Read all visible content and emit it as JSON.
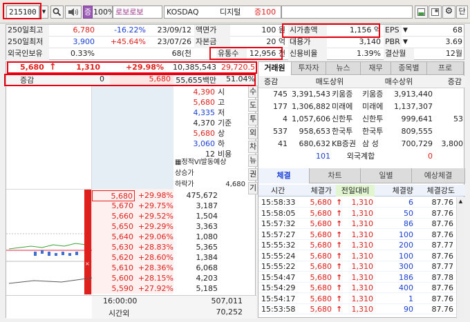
{
  "toolbar": {
    "code": "215100",
    "dropdown_glyph": "▾",
    "search_glyph": "🔍",
    "speaker_glyph": "◀)",
    "badge": "증",
    "margin": "100%",
    "name": "로보로보",
    "market": "KOSDAQ",
    "sector": "디지털",
    "margin_rate": "증100",
    "settings_glyph": "⚙",
    "single_label": "단"
  },
  "info": {
    "high250_label": "250일최고",
    "high250_value": "6,780",
    "high250_pct": "-16.22%",
    "high250_date": "23/09/12",
    "par_label": "액면가",
    "par_value": "100 원",
    "mcap_label": "시가총액",
    "mcap_value": "1,156 억",
    "eps_label": "EPS",
    "eps_value": "68",
    "low250_label": "250일최저",
    "low250_value": "3,900",
    "low250_pct": "+45.64%",
    "low250_date": "23/07/26",
    "capital_label": "자본금",
    "capital_value": "20 억",
    "loan_label": "대용가",
    "loan_value": "3,140",
    "pbr_label": "PBR",
    "pbr_value": "3.69",
    "foreign_label": "외국인보유",
    "foreign_value": "0.33%",
    "shares_value": "68(천",
    "float_label": "유통수",
    "float_value": "12,956 천",
    "credit_label": "신용비율",
    "credit_value": "1.39%",
    "fiscal_label": "결산월",
    "fiscal_value": "12월"
  },
  "quote": {
    "price": "5,680",
    "arrow": "↑",
    "change": "1,310",
    "pct": "+29.98%",
    "volume": "10,385,543",
    "amount": "29,720.5",
    "diff_label": "증감",
    "diff_value": "0",
    "ref_price": "5,680",
    "trade_amount": "55,655백만",
    "strength": "51.04%"
  },
  "summary": [
    {
      "value": "4,390",
      "label": "시"
    },
    {
      "value": "5,680",
      "label": "고"
    },
    {
      "value": "4,335",
      "label": "저"
    },
    {
      "value": "4,370",
      "label": "기준"
    },
    {
      "value": "5,680",
      "label": "상"
    },
    {
      "value": "3,060",
      "label": "하"
    },
    {
      "value": "12",
      "label": "비용"
    }
  ],
  "vi": {
    "title": "정적VI발동예상",
    "up_label": "상승가",
    "down_label": "하락가",
    "down_value": "4,680"
  },
  "vertical_buttons": [
    "수",
    "도",
    "투",
    "외",
    "차",
    "뉴",
    "권",
    "기"
  ],
  "ladder": [
    {
      "price": "5,680",
      "pct": "+29.98%",
      "qty": "475,672"
    },
    {
      "price": "5,670",
      "pct": "+29.75%",
      "qty": "3,187"
    },
    {
      "price": "5,660",
      "pct": "+29.52%",
      "qty": "1,504"
    },
    {
      "price": "5,650",
      "pct": "+29.29%",
      "qty": "3,363"
    },
    {
      "price": "5,640",
      "pct": "+29.06%",
      "qty": "1,080"
    },
    {
      "price": "5,630",
      "pct": "+28.83%",
      "qty": "5,365"
    },
    {
      "price": "5,620",
      "pct": "+28.60%",
      "qty": "1,384"
    },
    {
      "price": "5,610",
      "pct": "+28.36%",
      "qty": "6,068"
    },
    {
      "price": "5,600",
      "pct": "+28.15%",
      "qty": "4,203"
    },
    {
      "price": "5,590",
      "pct": "+27.92%",
      "qty": "5,185"
    }
  ],
  "ladder_footer": {
    "time": "16:00:00",
    "time_total": "507,011",
    "after_label": "시간외",
    "after_total": "70,252"
  },
  "right_tabs": [
    "거래원",
    "투자자",
    "뉴스",
    "재무",
    "종목별",
    "프로"
  ],
  "members": {
    "diff_label": "증감",
    "sell_label": "매도상위",
    "buy_label": "매수상위",
    "rows": [
      {
        "sdiff": "745",
        "sqty": "3,391,543",
        "sfirm": "키움증",
        "bfirm": "키움증",
        "bqty": "3,913,440",
        "bdiff": ""
      },
      {
        "sdiff": "177",
        "sqty": "1,306,882",
        "sfirm": "미래에",
        "bfirm": "미래에",
        "bqty": "1,137,307",
        "bdiff": ""
      },
      {
        "sdiff": "4",
        "sqty": "1,057,606",
        "sfirm": "신한투",
        "bfirm": "신한투",
        "bqty": "999,641",
        "bdiff": "53"
      },
      {
        "sdiff": "537",
        "sqty": "958,653",
        "sfirm": "한국투",
        "bfirm": "한국투",
        "bqty": "809,555",
        "bdiff": ""
      },
      {
        "sdiff": "41",
        "sqty": "680,632",
        "sfirm": "KB증권",
        "bfirm": "삼  성",
        "bqty": "700,729",
        "bdiff": "3,800"
      }
    ],
    "foreign_left": "101",
    "foreign_label": "외국계합",
    "foreign_right": "0"
  },
  "trade_tabs": [
    "체결",
    "차트",
    "일별",
    "예상체결"
  ],
  "trades": {
    "headers": [
      "시간",
      "체결가",
      "전일대비",
      "체결량",
      "체결강도"
    ],
    "rows": [
      {
        "time": "15:58:33",
        "price": "5,680",
        "change": "1,310",
        "qty": "6",
        "strength": "87.76"
      },
      {
        "time": "15:58:05",
        "price": "5,680",
        "change": "1,310",
        "qty": "50",
        "strength": "87.76"
      },
      {
        "time": "15:57:32",
        "price": "5,680",
        "change": "1,310",
        "qty": "86",
        "strength": "87.76"
      },
      {
        "time": "15:57:27",
        "price": "5,680",
        "change": "1,310",
        "qty": "100",
        "strength": "87.76"
      },
      {
        "time": "15:55:32",
        "price": "5,680",
        "change": "1,310",
        "qty": "200",
        "strength": "87.77"
      },
      {
        "time": "15:55:24",
        "price": "5,680",
        "change": "1,310",
        "qty": "100",
        "strength": "87.76"
      },
      {
        "time": "15:55:22",
        "price": "5,680",
        "change": "1,310",
        "qty": "300",
        "strength": "87.77"
      },
      {
        "time": "15:54:47",
        "price": "5,680",
        "change": "1,310",
        "qty": "186",
        "strength": "87.78"
      },
      {
        "time": "15:54:29",
        "price": "5,680",
        "change": "1,310",
        "qty": "400",
        "strength": "87.76"
      },
      {
        "time": "15:54:17",
        "price": "5,680",
        "change": "1,310",
        "qty": "1",
        "strength": "87.76"
      },
      {
        "time": "15:53:58",
        "price": "5,680",
        "change": "1,310",
        "qty": "90",
        "strength": "87.76"
      }
    ]
  },
  "colors": {
    "up": "#e0201c",
    "down": "#1a3fd6",
    "highlight": "#e60012"
  }
}
